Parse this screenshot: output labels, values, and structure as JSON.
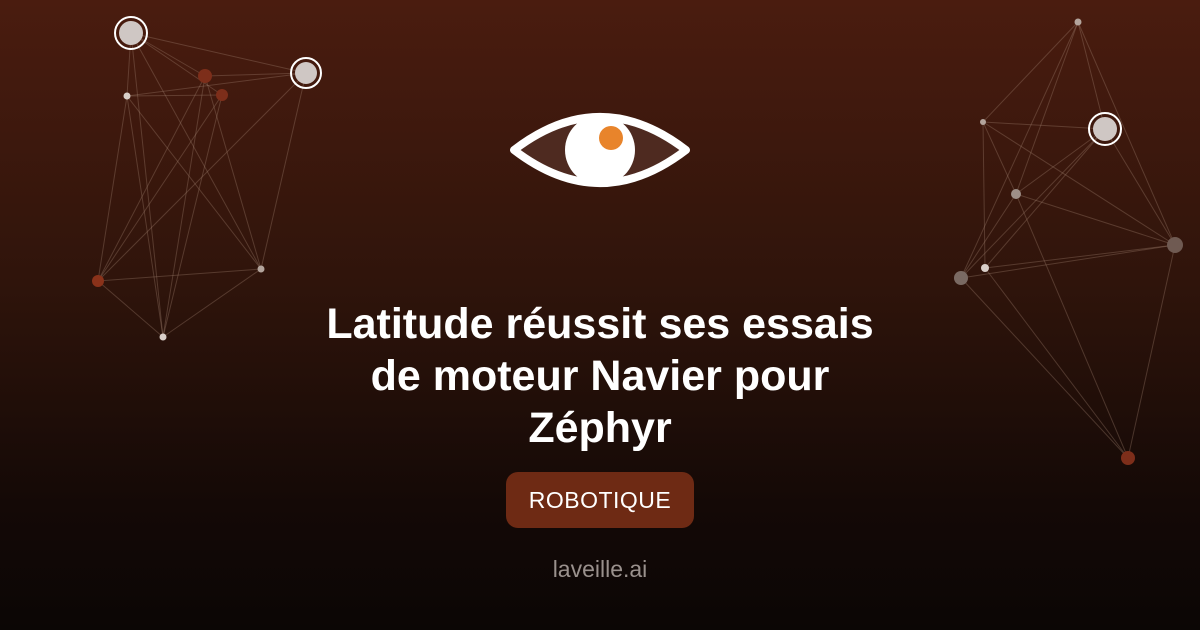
{
  "article": {
    "title_lines": [
      "Latitude réussit ses essais",
      "de moteur Navier pour",
      "Zéphyr"
    ]
  },
  "category": {
    "label": "ROBOTIQUE"
  },
  "site": {
    "name": "laveille.ai"
  },
  "icons": {
    "logo": "eye-icon"
  },
  "colors": {
    "background_top": "#4a1c0f",
    "background_bottom": "#0b0605",
    "accent": "#e8842b",
    "tag_background": "#6e2a14",
    "text": "#ffffff",
    "muted_text": "#9a918d"
  }
}
